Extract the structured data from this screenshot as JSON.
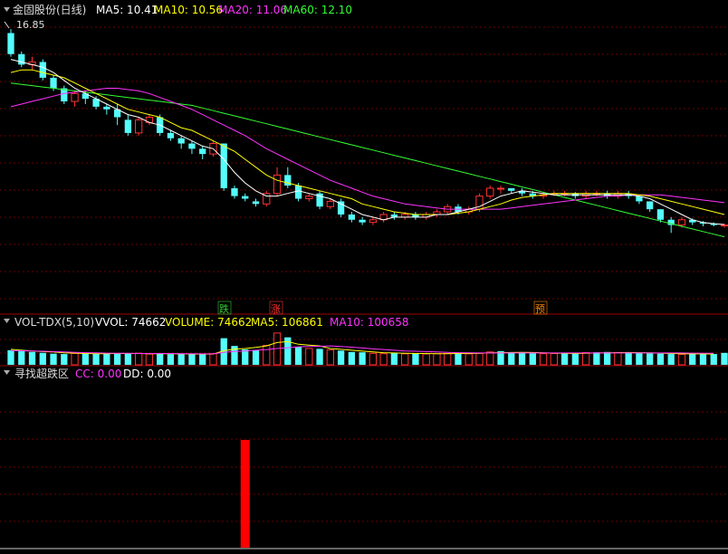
{
  "price_panel": {
    "title": "金固股份(日线)",
    "ma_labels": [
      {
        "text": "MA5: 10.41",
        "color": "#ffffff"
      },
      {
        "text": "MA10: 10.56",
        "color": "#ffff00"
      },
      {
        "text": "MA20: 11.06",
        "color": "#ff33ff"
      },
      {
        "text": "MA60: 12.10",
        "color": "#33ff33"
      }
    ],
    "high_label": "16.85",
    "signals": [
      {
        "text": "跌",
        "color": "#33cc33"
      },
      {
        "text": "涨",
        "color": "#ff3333"
      },
      {
        "text": "预",
        "color": "#ff8800"
      }
    ]
  },
  "volume_panel": {
    "title": "VOL-TDX(5,10)",
    "labels": [
      {
        "text": "VVOL: 74662",
        "color": "#ffffff"
      },
      {
        "text": "VOLUME: 74662",
        "color": "#ffff00"
      },
      {
        "text": "MA5: 106861",
        "color": "#ffff00"
      },
      {
        "text": "MA10: 100658",
        "color": "#ff33ff"
      }
    ]
  },
  "indicator_panel": {
    "title": "寻找超跌区",
    "labels": [
      {
        "text": "CC: 0.00",
        "color": "#ff33ff"
      },
      {
        "text": "DD: 0.00",
        "color": "#ffffff"
      }
    ]
  },
  "colors": {
    "up": "#ff3333",
    "down": "#54fcfc",
    "grid": "#6e0000",
    "separator": "#9b0000",
    "signal_bar": "#ff0000"
  },
  "chart_data": [
    {
      "type": "candlestick",
      "title": "金固股份(日线)",
      "x": [
        0,
        1,
        2,
        3,
        4,
        5,
        6,
        7,
        8,
        9,
        10,
        11,
        12,
        13,
        14,
        15,
        16,
        17,
        18,
        19,
        20,
        21,
        22,
        23,
        24,
        25,
        26,
        27,
        28,
        29,
        30,
        31,
        32,
        33,
        34,
        35,
        36,
        37,
        38,
        39,
        40,
        41,
        42,
        43,
        44,
        45,
        46,
        47,
        48,
        49,
        50,
        51,
        52,
        53,
        54,
        55,
        56,
        57,
        58,
        59,
        60,
        61,
        62,
        63,
        64,
        65,
        66,
        67
      ],
      "open": [
        16.7,
        15.9,
        15.5,
        15.6,
        15.0,
        14.6,
        14.1,
        14.4,
        14.2,
        13.9,
        13.8,
        13.4,
        12.9,
        13.3,
        13.5,
        12.9,
        12.7,
        12.5,
        12.3,
        12.1,
        12.5,
        10.8,
        10.5,
        10.3,
        10.2,
        10.6,
        11.3,
        10.9,
        10.4,
        10.6,
        10.1,
        10.3,
        9.8,
        9.6,
        9.5,
        9.6,
        9.8,
        9.7,
        9.8,
        9.7,
        9.8,
        9.9,
        10.1,
        9.9,
        10.0,
        10.5,
        10.8,
        10.8,
        10.7,
        10.6,
        10.5,
        10.55,
        10.6,
        10.6,
        10.5,
        10.6,
        10.6,
        10.5,
        10.6,
        10.5,
        10.3,
        10.0,
        9.6,
        9.4,
        9.6,
        9.5,
        9.45,
        9.4
      ],
      "close": [
        15.9,
        15.5,
        15.6,
        15.0,
        14.6,
        14.1,
        14.4,
        14.2,
        13.9,
        13.8,
        13.5,
        12.9,
        13.4,
        13.5,
        12.9,
        12.7,
        12.5,
        12.3,
        12.1,
        12.5,
        10.8,
        10.5,
        10.4,
        10.2,
        10.6,
        11.3,
        10.9,
        10.4,
        10.5,
        10.1,
        10.3,
        9.8,
        9.6,
        9.5,
        9.6,
        9.8,
        9.7,
        9.8,
        9.7,
        9.8,
        9.9,
        10.1,
        9.9,
        10.0,
        10.5,
        10.8,
        10.8,
        10.7,
        10.6,
        10.5,
        10.55,
        10.6,
        10.6,
        10.5,
        10.6,
        10.6,
        10.5,
        10.6,
        10.5,
        10.3,
        10.0,
        9.6,
        9.4,
        9.6,
        9.5,
        9.45,
        9.4,
        9.4
      ],
      "high": [
        16.85,
        16.0,
        15.8,
        15.7,
        15.1,
        14.7,
        14.5,
        14.5,
        14.3,
        14.0,
        14.0,
        13.6,
        13.5,
        13.6,
        13.6,
        13.0,
        12.8,
        12.6,
        12.4,
        12.6,
        12.5,
        10.9,
        10.6,
        10.4,
        10.7,
        11.6,
        11.6,
        11.0,
        10.6,
        10.7,
        10.4,
        10.4,
        9.9,
        9.7,
        9.7,
        9.9,
        9.9,
        9.9,
        9.9,
        9.9,
        10.0,
        10.2,
        10.2,
        10.1,
        10.6,
        10.9,
        10.9,
        10.8,
        10.8,
        10.7,
        10.65,
        10.7,
        10.7,
        10.65,
        10.7,
        10.7,
        10.7,
        10.7,
        10.7,
        10.5,
        10.3,
        10.0,
        9.7,
        9.7,
        9.65,
        9.55,
        9.5,
        9.45
      ],
      "low": [
        15.8,
        15.4,
        15.3,
        14.9,
        14.5,
        14.0,
        13.9,
        14.0,
        13.8,
        13.6,
        13.2,
        12.8,
        12.8,
        13.2,
        12.8,
        12.6,
        12.3,
        12.1,
        11.9,
        12.0,
        10.7,
        10.4,
        10.3,
        10.1,
        10.1,
        10.5,
        10.8,
        10.3,
        10.3,
        10.0,
        10.0,
        9.7,
        9.5,
        9.4,
        9.4,
        9.5,
        9.6,
        9.6,
        9.6,
        9.6,
        9.7,
        9.8,
        9.8,
        9.8,
        9.9,
        10.4,
        10.6,
        10.6,
        10.5,
        10.4,
        10.4,
        10.5,
        10.5,
        10.4,
        10.4,
        10.5,
        10.4,
        10.4,
        10.4,
        10.2,
        9.9,
        9.5,
        9.1,
        9.3,
        9.4,
        9.35,
        9.35,
        9.3
      ],
      "ma5": [
        15.7,
        15.6,
        15.5,
        15.4,
        15.2,
        14.9,
        14.6,
        14.4,
        14.2,
        14.0,
        13.8,
        13.6,
        13.5,
        13.3,
        13.2,
        13.0,
        12.8,
        12.6,
        12.4,
        12.3,
        11.9,
        11.4,
        11.0,
        10.7,
        10.5,
        10.5,
        10.6,
        10.7,
        10.6,
        10.5,
        10.4,
        10.2,
        10.0,
        9.8,
        9.7,
        9.6,
        9.7,
        9.7,
        9.7,
        9.7,
        9.8,
        9.8,
        9.9,
        10.0,
        10.1,
        10.3,
        10.5,
        10.6,
        10.7,
        10.65,
        10.6,
        10.55,
        10.55,
        10.55,
        10.55,
        10.55,
        10.55,
        10.55,
        10.55,
        10.5,
        10.4,
        10.2,
        10.0,
        9.8,
        9.6,
        9.5,
        9.45,
        9.42
      ],
      "ma10": [
        15.2,
        15.3,
        15.3,
        15.2,
        15.1,
        15.0,
        14.8,
        14.6,
        14.4,
        14.2,
        14.0,
        13.8,
        13.7,
        13.6,
        13.5,
        13.3,
        13.1,
        13.0,
        12.8,
        12.6,
        12.4,
        12.2,
        11.9,
        11.6,
        11.3,
        11.1,
        11.0,
        10.9,
        10.8,
        10.7,
        10.6,
        10.5,
        10.4,
        10.2,
        10.1,
        10.0,
        9.9,
        9.85,
        9.8,
        9.8,
        9.8,
        9.8,
        9.85,
        9.9,
        10.0,
        10.1,
        10.2,
        10.35,
        10.45,
        10.5,
        10.55,
        10.6,
        10.6,
        10.6,
        10.6,
        10.6,
        10.6,
        10.6,
        10.6,
        10.55,
        10.5,
        10.4,
        10.3,
        10.2,
        10.1,
        10.0,
        9.9,
        9.8
      ],
      "ma20": [
        13.9,
        14.0,
        14.1,
        14.2,
        14.3,
        14.4,
        14.45,
        14.5,
        14.55,
        14.6,
        14.6,
        14.55,
        14.5,
        14.4,
        14.25,
        14.1,
        13.95,
        13.8,
        13.6,
        13.4,
        13.2,
        13.0,
        12.8,
        12.55,
        12.3,
        12.1,
        11.9,
        11.7,
        11.5,
        11.3,
        11.1,
        10.95,
        10.8,
        10.65,
        10.5,
        10.4,
        10.3,
        10.2,
        10.15,
        10.1,
        10.05,
        10.0,
        10.0,
        10.0,
        10.0,
        10.0,
        10.0,
        10.05,
        10.1,
        10.15,
        10.2,
        10.25,
        10.3,
        10.35,
        10.4,
        10.45,
        10.5,
        10.5,
        10.55,
        10.55,
        10.55,
        10.55,
        10.5,
        10.45,
        10.4,
        10.35,
        10.3,
        10.25
      ],
      "ma60": [
        14.8,
        14.75,
        14.7,
        14.65,
        14.6,
        14.55,
        14.5,
        14.45,
        14.4,
        14.35,
        14.3,
        14.25,
        14.2,
        14.15,
        14.1,
        14.05,
        14.0,
        13.95,
        13.85,
        13.75,
        13.65,
        13.55,
        13.45,
        13.35,
        13.25,
        13.15,
        13.05,
        12.95,
        12.85,
        12.75,
        12.65,
        12.55,
        12.45,
        12.35,
        12.25,
        12.15,
        12.05,
        11.95,
        11.85,
        11.75,
        11.65,
        11.55,
        11.45,
        11.35,
        11.25,
        11.15,
        11.05,
        10.95,
        10.85,
        10.75,
        10.65,
        10.55,
        10.45,
        10.35,
        10.25,
        10.15,
        10.05,
        9.95,
        9.85,
        9.75,
        9.65,
        9.55,
        9.45,
        9.35,
        9.25,
        9.15,
        9.05,
        8.95
      ],
      "ylim": [
        8.8,
        17.2
      ]
    },
    {
      "type": "bar",
      "title": "VOL-TDX(5,10)",
      "x": [
        0,
        1,
        2,
        3,
        4,
        5,
        6,
        7,
        8,
        9,
        10,
        11,
        12,
        13,
        14,
        15,
        16,
        17,
        18,
        19,
        20,
        21,
        22,
        23,
        24,
        25,
        26,
        27,
        28,
        29,
        30,
        31,
        32,
        33,
        34,
        35,
        36,
        37,
        38,
        39,
        40,
        41,
        42,
        43,
        44,
        45,
        46,
        47,
        48,
        49,
        50,
        51,
        52,
        53,
        54,
        55,
        56,
        57,
        58,
        59,
        60,
        61,
        62,
        63,
        64,
        65,
        66,
        67
      ],
      "volume": [
        90000,
        85000,
        80000,
        75000,
        70000,
        68000,
        72000,
        70000,
        69000,
        71000,
        74000,
        72000,
        73000,
        68000,
        70000,
        67000,
        69000,
        66000,
        68000,
        70000,
        160000,
        115000,
        95000,
        90000,
        118000,
        190000,
        165000,
        110000,
        100000,
        98000,
        92000,
        88000,
        80000,
        78000,
        72000,
        70000,
        74000,
        69000,
        72000,
        68000,
        70000,
        71000,
        75000,
        69000,
        72000,
        80000,
        85000,
        78000,
        76000,
        72000,
        70000,
        71000,
        72000,
        70000,
        76000,
        78000,
        80000,
        77000,
        75000,
        73000,
        71000,
        70000,
        68000,
        66000,
        70000,
        69000,
        68000,
        74662
      ],
      "up": [
        false,
        false,
        false,
        false,
        false,
        false,
        true,
        false,
        false,
        false,
        false,
        false,
        true,
        true,
        false,
        false,
        false,
        false,
        false,
        true,
        false,
        false,
        false,
        false,
        true,
        true,
        false,
        false,
        true,
        false,
        true,
        false,
        false,
        false,
        true,
        true,
        false,
        true,
        false,
        true,
        true,
        true,
        false,
        true,
        true,
        true,
        false,
        false,
        false,
        false,
        true,
        true,
        false,
        false,
        true,
        false,
        false,
        true,
        false,
        false,
        false,
        false,
        false,
        true,
        false,
        false,
        false,
        false
      ],
      "ma5": [
        95000,
        90000,
        86000,
        82000,
        80000,
        75000,
        73000,
        71000,
        70000,
        70000,
        71000,
        71000,
        71000,
        70000,
        70000,
        70000,
        69000,
        68000,
        68000,
        68000,
        87000,
        97000,
        100000,
        107000,
        115000,
        135000,
        140000,
        125000,
        120000,
        115000,
        100000,
        95000,
        90000,
        85000,
        80000,
        76000,
        74000,
        72000,
        71000,
        71000,
        70000,
        70000,
        71000,
        71000,
        72000,
        75000,
        76000,
        77000,
        78000,
        77000,
        75000,
        73000,
        72000,
        71000,
        72000,
        74000,
        75000,
        76000,
        77000,
        76000,
        75000,
        73000,
        71000,
        70000,
        69000,
        69000,
        68000,
        106861
      ],
      "ma10": [
        88000,
        87000,
        86000,
        84000,
        82000,
        80000,
        78000,
        76000,
        75000,
        73000,
        72000,
        72000,
        71000,
        71000,
        71000,
        71000,
        70000,
        70000,
        69000,
        69000,
        78000,
        83000,
        86000,
        90000,
        93000,
        100000,
        105000,
        110000,
        112000,
        113000,
        115000,
        112000,
        108000,
        103000,
        98000,
        94000,
        90000,
        86000,
        84000,
        82000,
        80000,
        78000,
        76000,
        75000,
        74000,
        74000,
        74000,
        74000,
        74000,
        74000,
        74000,
        74000,
        74000,
        74000,
        74000,
        74000,
        74000,
        74000,
        74000,
        74000,
        74000,
        74000,
        74000,
        74000,
        73000,
        72000,
        72000,
        100658
      ],
      "ylim": [
        0,
        200000
      ]
    },
    {
      "type": "bar",
      "title": "寻找超跌区",
      "x": [
        0,
        1,
        2,
        3,
        4,
        5,
        6,
        7,
        8,
        9,
        10,
        11,
        12,
        13,
        14,
        15,
        16,
        17,
        18,
        19,
        20,
        21,
        22,
        23,
        24,
        25,
        26,
        27,
        28,
        29,
        30,
        31,
        32,
        33,
        34,
        35,
        36,
        37,
        38,
        39,
        40,
        41,
        42,
        43,
        44,
        45,
        46,
        47,
        48,
        49,
        50,
        51,
        52,
        53,
        54,
        55,
        56,
        57,
        58,
        59,
        60,
        61,
        62,
        63,
        64,
        65,
        66,
        67
      ],
      "values": [
        0,
        0,
        0,
        0,
        0,
        0,
        0,
        0,
        0,
        0,
        0,
        0,
        0,
        0,
        0,
        0,
        0,
        0,
        0,
        0,
        0,
        0,
        100,
        0,
        0,
        0,
        0,
        0,
        0,
        0,
        0,
        0,
        0,
        0,
        0,
        0,
        0,
        0,
        0,
        0,
        0,
        0,
        0,
        0,
        0,
        0,
        0,
        0,
        0,
        0,
        0,
        0,
        0,
        0,
        0,
        0,
        0,
        0,
        0,
        0,
        0,
        0,
        0,
        0,
        0,
        0,
        0,
        0
      ],
      "ylim": [
        0,
        100
      ]
    }
  ]
}
